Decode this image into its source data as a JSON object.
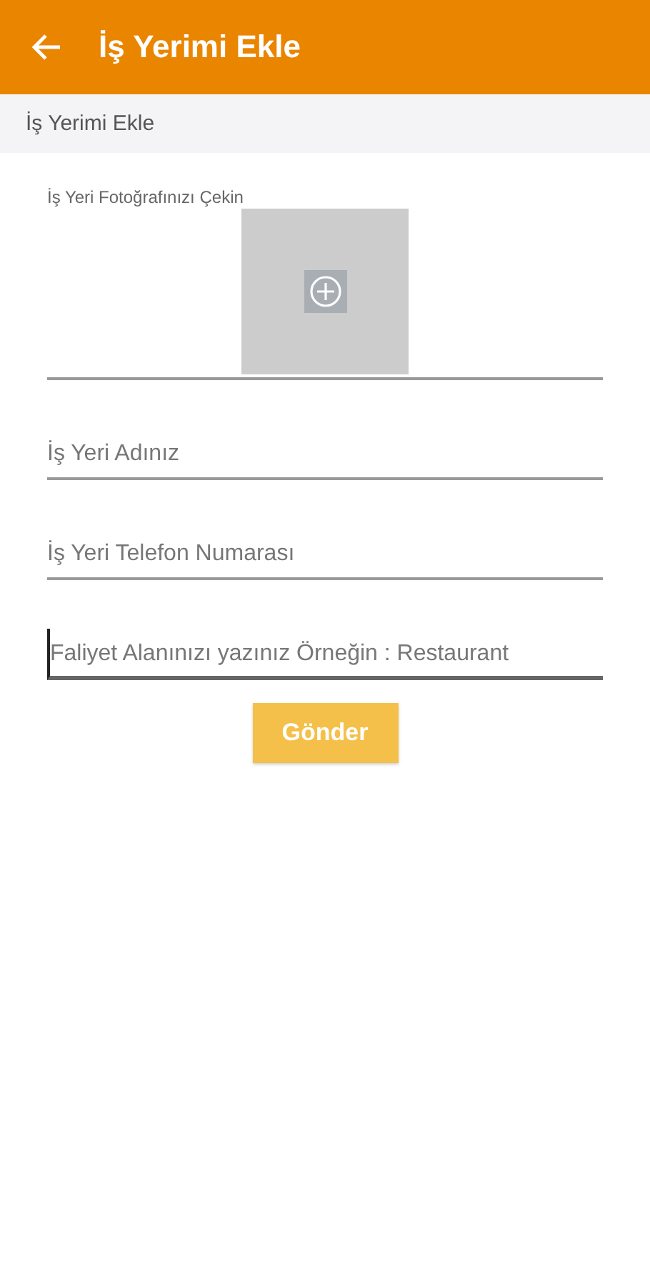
{
  "app_bar": {
    "title": "İş Yerimi Ekle"
  },
  "section_header": {
    "title": "İş Yerimi Ekle"
  },
  "photo": {
    "label": "İş Yeri Fotoğrafınızı Çekin"
  },
  "fields": [
    {
      "placeholder": "İş Yeri Adınız",
      "focused": false
    },
    {
      "placeholder": "İş Yeri Telefon Numarası",
      "focused": false
    },
    {
      "placeholder": "Faliyet Alanınızı yazınız Örneğin : Restaurant",
      "focused": true
    }
  ],
  "submit": {
    "label": "Gönder"
  }
}
